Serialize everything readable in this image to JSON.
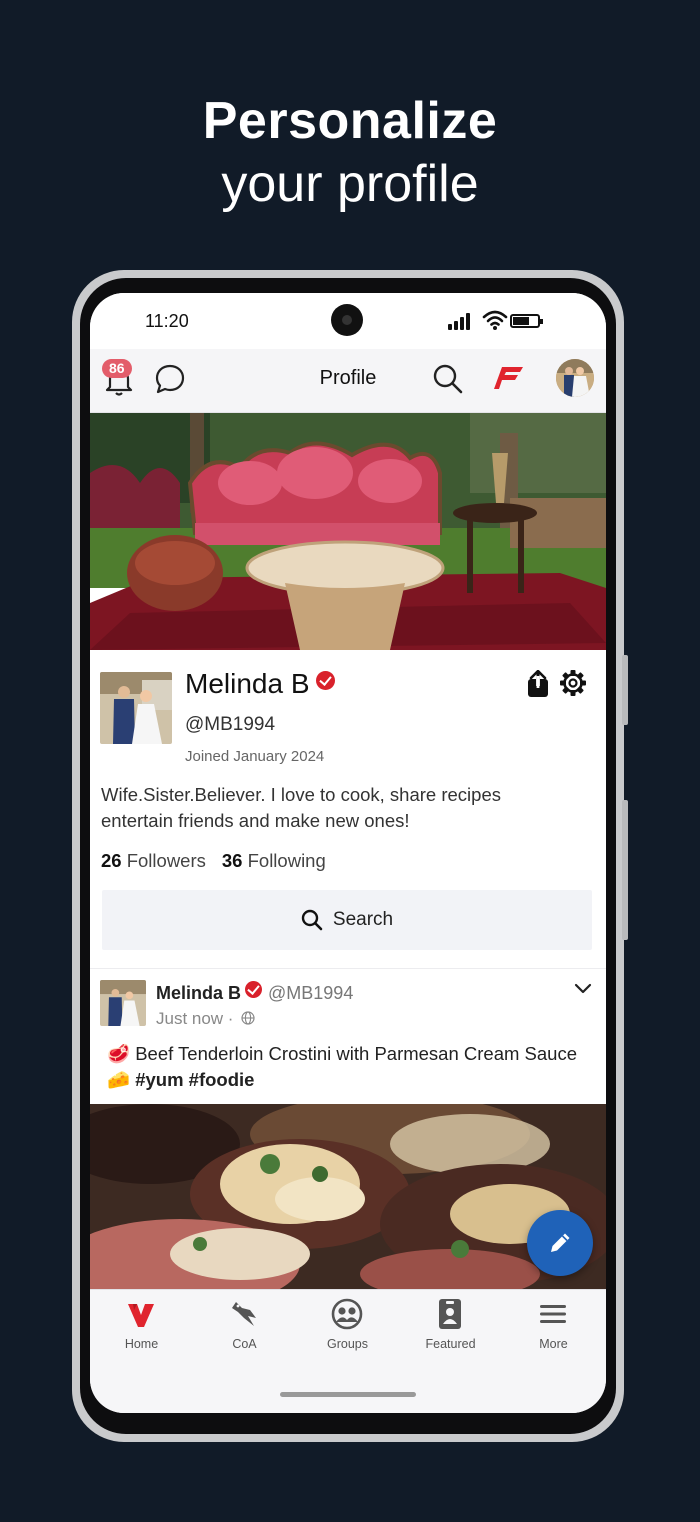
{
  "headline": {
    "line1": "Personalize",
    "line2": "your profile"
  },
  "status_bar": {
    "time": "11:20"
  },
  "top_nav": {
    "title": "Profile",
    "notification_count": "86",
    "accent_color": "#e0242e"
  },
  "profile": {
    "name": "Melinda B",
    "handle": "@MB1994",
    "joined": "Joined January 2024",
    "bio": "Wife.Sister.Believer. I love to cook, share recipes entertain friends and make new ones!",
    "followers_count": "26",
    "followers_label": "Followers",
    "following_count": "36",
    "following_label": "Following",
    "search_label": "Search"
  },
  "post": {
    "author": "Melinda B",
    "handle": "@MB1994",
    "time": "Just now ·",
    "text_part1": "Beef Tenderloin Crostini with Parmesan Cream Sauce",
    "emoji_start": "🥩",
    "emoji_mid": "🧀",
    "hashtags": "#yum #foodie"
  },
  "bottom_nav": {
    "tabs": [
      {
        "label": "Home",
        "icon": "home-logo-icon",
        "active": true
      },
      {
        "label": "CoA",
        "icon": "eagle-icon"
      },
      {
        "label": "Groups",
        "icon": "groups-icon"
      },
      {
        "label": "Featured",
        "icon": "featured-badge-icon"
      },
      {
        "label": "More",
        "icon": "menu-icon"
      }
    ]
  },
  "colors": {
    "background": "#111b28",
    "brand_red": "#e0242e",
    "fab_blue": "#1f62b8",
    "verified_red": "#d9212b"
  }
}
